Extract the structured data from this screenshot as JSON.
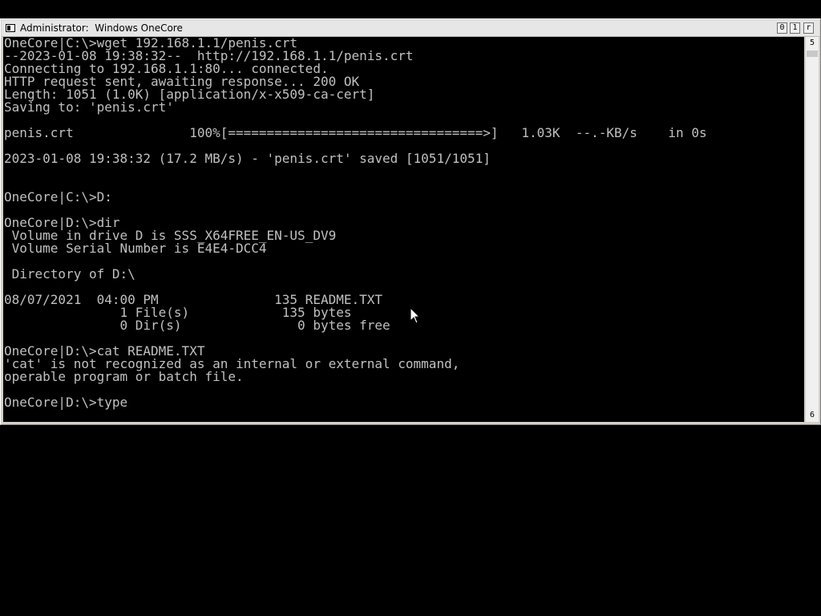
{
  "window": {
    "title": "Administrator:  Windows OneCore",
    "buttons": {
      "minimize": "0",
      "maximize": "1",
      "close": "r"
    }
  },
  "scrollbar": {
    "up_arrow": "5",
    "down_arrow": "6"
  },
  "console": {
    "text_color": "#c0c0c0",
    "background": "#000000",
    "lines": [
      "OneCore|C:\\>wget 192.168.1.1/penis.crt",
      "--2023-01-08 19:38:32--  http://192.168.1.1/penis.crt",
      "Connecting to 192.168.1.1:80... connected.",
      "HTTP request sent, awaiting response... 200 OK",
      "Length: 1051 (1.0K) [application/x-x509-ca-cert]",
      "Saving to: 'penis.crt'",
      "",
      "penis.crt               100%[=================================>]   1.03K  --.-KB/s    in 0s",
      "",
      "2023-01-08 19:38:32 (17.2 MB/s) - 'penis.crt' saved [1051/1051]",
      "",
      "",
      "OneCore|C:\\>D:",
      "",
      "OneCore|D:\\>dir",
      " Volume in drive D is SSS_X64FREE_EN-US_DV9",
      " Volume Serial Number is E4E4-DCC4",
      "",
      " Directory of D:\\",
      "",
      "08/07/2021  04:00 PM               135 README.TXT",
      "               1 File(s)            135 bytes",
      "               0 Dir(s)               0 bytes free",
      "",
      "OneCore|D:\\>cat README.TXT",
      "'cat' is not recognized as an internal or external command,",
      "operable program or batch file.",
      "",
      "OneCore|D:\\>type"
    ]
  }
}
